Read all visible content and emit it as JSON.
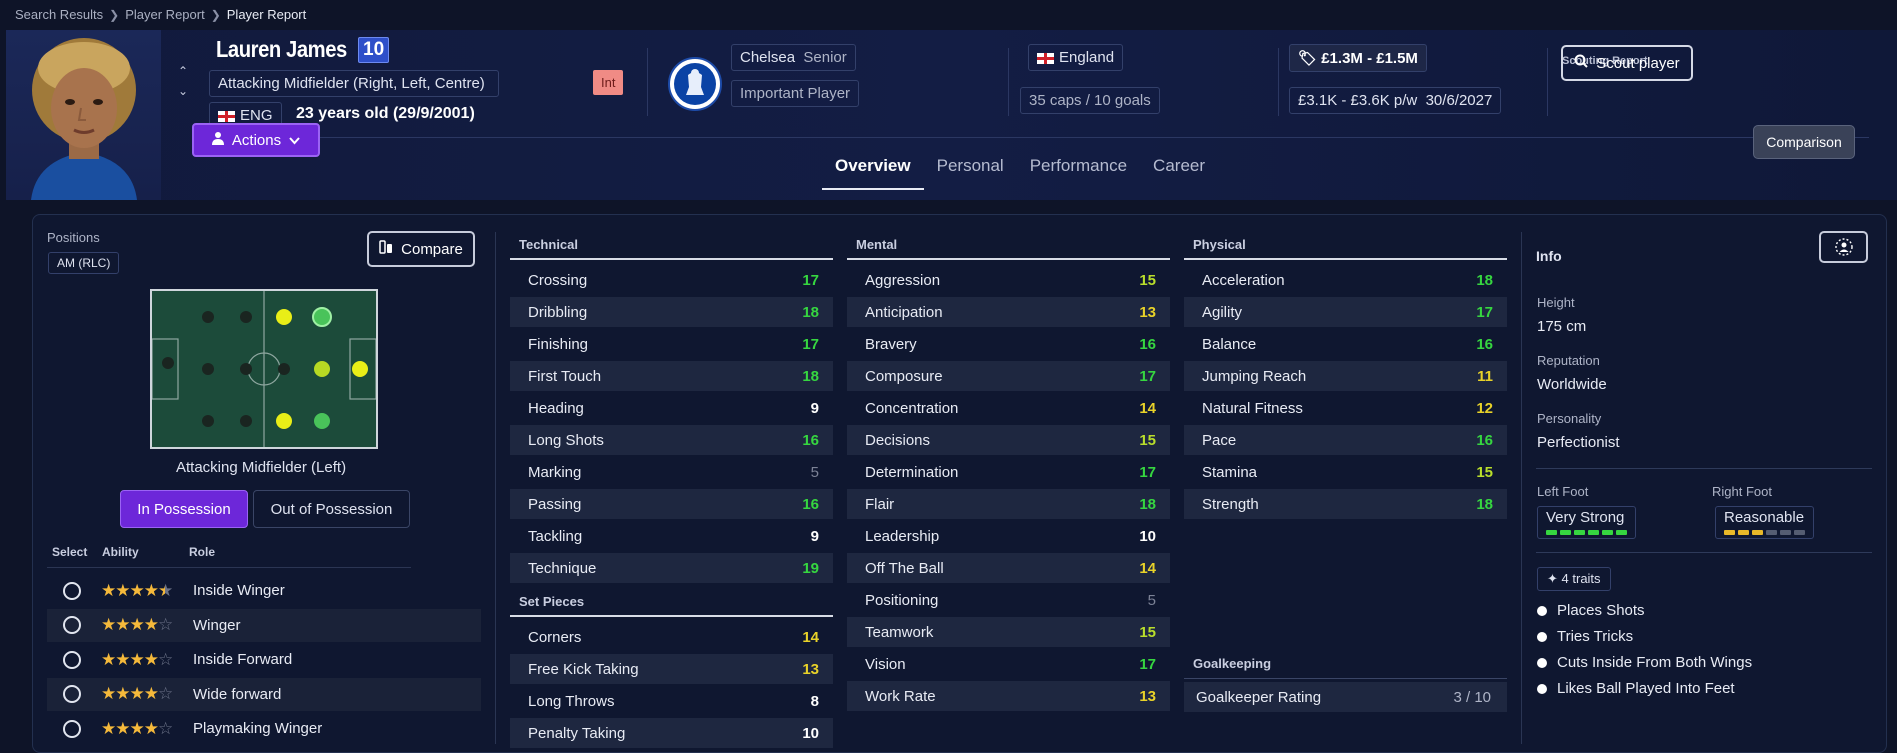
{
  "breadcrumb": [
    "Search Results",
    "Player Report",
    "Player Report"
  ],
  "player": {
    "name": "Lauren James",
    "number": "10",
    "position": "Attacking Midfielder (Right, Left, Centre)",
    "nationality_code": "ENG",
    "age": "23 years old (29/9/2001)",
    "int_badge": "Int"
  },
  "club": {
    "name": "Chelsea",
    "squad": "Senior",
    "status": "Important Player"
  },
  "nation": {
    "name": "England",
    "caps": "35 caps / 10 goals"
  },
  "value": {
    "range": "£1.3M - £1.5M",
    "wage": "£3.1K - £3.6K p/w",
    "contract_end": "30/6/2027"
  },
  "scouting": {
    "label": "Scouting Report",
    "button": "Scout player"
  },
  "actions_label": "Actions",
  "tabs": [
    "Overview",
    "Personal",
    "Performance",
    "Career"
  ],
  "comparison_label": "Comparison",
  "positions": {
    "label": "Positions",
    "chip": "AM (RLC)",
    "compare_label": "Compare",
    "pitch_caption": "Attacking Midfielder (Left)",
    "in_possession": "In Possession",
    "out_possession": "Out of Possession"
  },
  "roles_header": {
    "select": "Select",
    "ability": "Ability",
    "role": "Role"
  },
  "roles": [
    {
      "stars": 4.5,
      "name": "Inside Winger"
    },
    {
      "stars": 4,
      "name": "Winger"
    },
    {
      "stars": 4,
      "name": "Inside Forward"
    },
    {
      "stars": 4,
      "name": "Wide forward"
    },
    {
      "stars": 4,
      "name": "Playmaking Winger"
    }
  ],
  "technical": {
    "title": "Technical",
    "attrs": [
      {
        "name": "Crossing",
        "value": "17"
      },
      {
        "name": "Dribbling",
        "value": "18"
      },
      {
        "name": "Finishing",
        "value": "17"
      },
      {
        "name": "First Touch",
        "value": "18"
      },
      {
        "name": "Heading",
        "value": "9"
      },
      {
        "name": "Long Shots",
        "value": "16"
      },
      {
        "name": "Marking",
        "value": "5"
      },
      {
        "name": "Passing",
        "value": "16"
      },
      {
        "name": "Tackling",
        "value": "9"
      },
      {
        "name": "Technique",
        "value": "19"
      }
    ]
  },
  "set_pieces": {
    "title": "Set Pieces",
    "attrs": [
      {
        "name": "Corners",
        "value": "14"
      },
      {
        "name": "Free Kick Taking",
        "value": "13"
      },
      {
        "name": "Long Throws",
        "value": "8"
      },
      {
        "name": "Penalty Taking",
        "value": "10"
      }
    ]
  },
  "mental": {
    "title": "Mental",
    "attrs": [
      {
        "name": "Aggression",
        "value": "15"
      },
      {
        "name": "Anticipation",
        "value": "13"
      },
      {
        "name": "Bravery",
        "value": "16"
      },
      {
        "name": "Composure",
        "value": "17"
      },
      {
        "name": "Concentration",
        "value": "14"
      },
      {
        "name": "Decisions",
        "value": "15"
      },
      {
        "name": "Determination",
        "value": "17"
      },
      {
        "name": "Flair",
        "value": "18"
      },
      {
        "name": "Leadership",
        "value": "10"
      },
      {
        "name": "Off The Ball",
        "value": "14"
      },
      {
        "name": "Positioning",
        "value": "5"
      },
      {
        "name": "Teamwork",
        "value": "15"
      },
      {
        "name": "Vision",
        "value": "17"
      },
      {
        "name": "Work Rate",
        "value": "13"
      }
    ]
  },
  "physical": {
    "title": "Physical",
    "attrs": [
      {
        "name": "Acceleration",
        "value": "18"
      },
      {
        "name": "Agility",
        "value": "17"
      },
      {
        "name": "Balance",
        "value": "16"
      },
      {
        "name": "Jumping Reach",
        "value": "11"
      },
      {
        "name": "Natural Fitness",
        "value": "12"
      },
      {
        "name": "Pace",
        "value": "16"
      },
      {
        "name": "Stamina",
        "value": "15"
      },
      {
        "name": "Strength",
        "value": "18"
      }
    ]
  },
  "goalkeeping": {
    "title": "Goalkeeping",
    "rating_label": "Goalkeeper Rating",
    "rating_value": "3 / 10"
  },
  "info": {
    "title": "Info",
    "height_label": "Height",
    "height": "175 cm",
    "reputation_label": "Reputation",
    "reputation": "Worldwide",
    "personality_label": "Personality",
    "personality": "Perfectionist",
    "left_foot_label": "Left Foot",
    "left_foot": "Very Strong",
    "left_foot_pips": 6,
    "right_foot_label": "Right Foot",
    "right_foot": "Reasonable",
    "right_foot_pips": 3,
    "traits_count": "4 traits",
    "traits": [
      "Places Shots",
      "Tries Tricks",
      "Cuts Inside From Both Wings",
      "Likes Ball Played Into Feet"
    ]
  },
  "colors": {
    "accent": "#6d27d9",
    "attr_green": "#36d640",
    "attr_lime": "#b9de2b",
    "attr_yellow": "#e8d229",
    "star": "#f5b93b"
  }
}
